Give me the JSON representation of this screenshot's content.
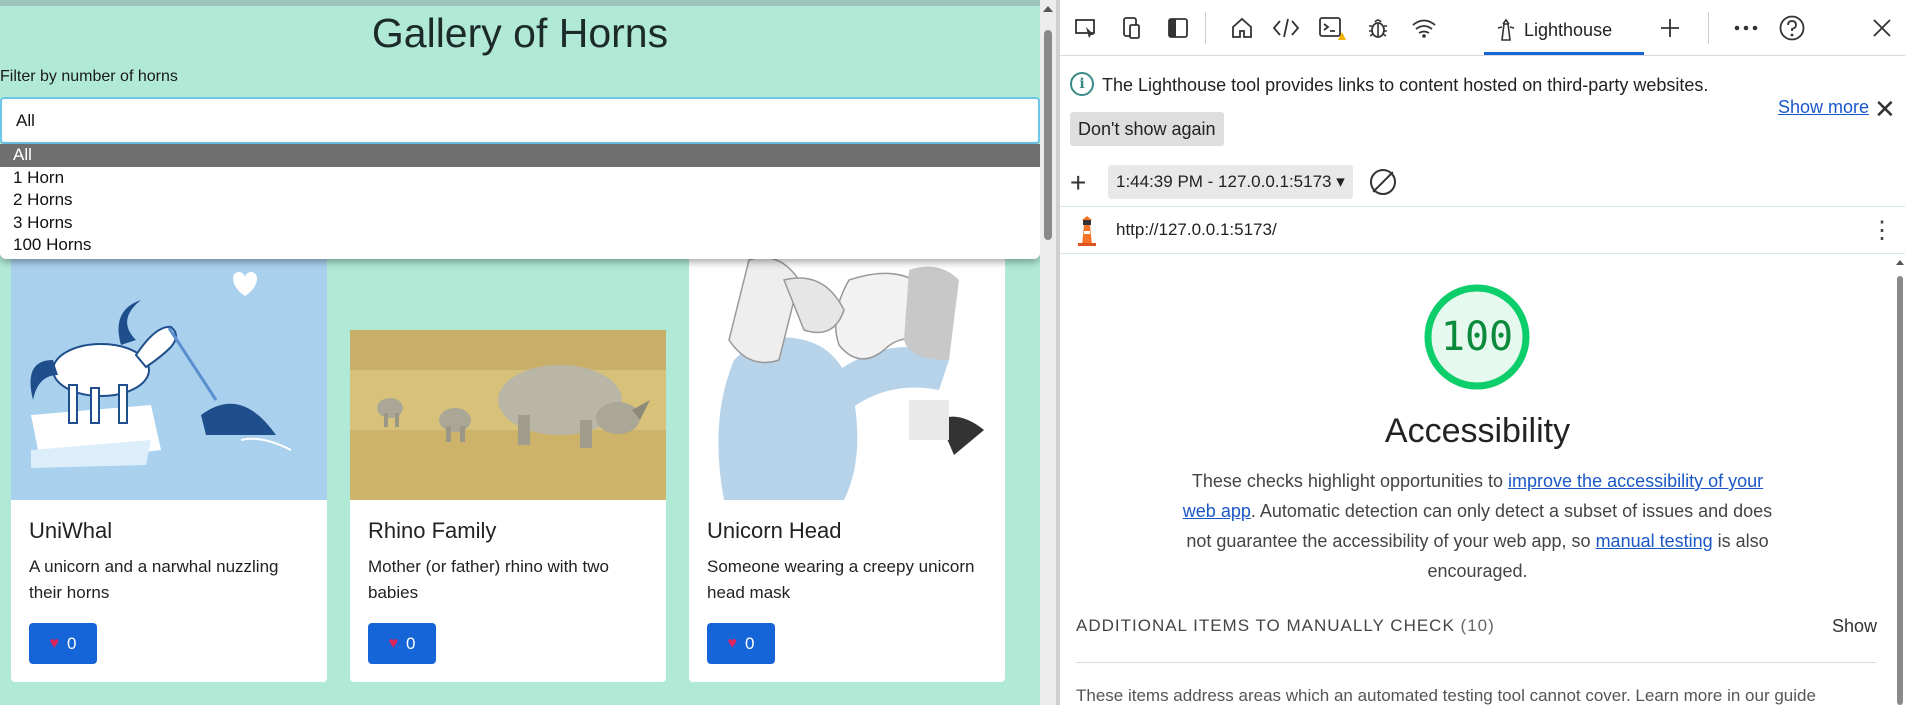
{
  "app": {
    "title": "Gallery of Horns",
    "filter_label": "Filter by number of horns",
    "filter_value": "All",
    "filter_options": [
      "All",
      "1 Horn",
      "2 Horns",
      "3 Horns",
      "100 Horns"
    ],
    "cards": [
      {
        "title": "UniWhal",
        "description": "A unicorn and a narwhal nuzzling their horns",
        "likes": "0"
      },
      {
        "title": "Rhino Family",
        "description": "Mother (or father) rhino with two babies",
        "likes": "0"
      },
      {
        "title": "Unicorn Head",
        "description": "Someone wearing a creepy unicorn head mask",
        "likes": "0"
      }
    ]
  },
  "devtools": {
    "active_tab": "Lighthouse",
    "toolbar_icons": [
      "inspect-icon",
      "device-icon",
      "dock-icon",
      "home-icon",
      "elements-icon",
      "console-icon",
      "bug-icon",
      "network-icon",
      "lighthouse-icon",
      "add-tab-icon",
      "more-icon",
      "help-icon",
      "close-icon"
    ],
    "infobar": {
      "message": "The Lighthouse tool provides links to content hosted on third-party websites.",
      "dont_show": "Don't show again",
      "show_more": "Show more"
    },
    "report_select": "1:44:39 PM - 127.0.0.1:5173",
    "url": "http://127.0.0.1:5173/",
    "score": "100",
    "score_fraction": 1.0,
    "category_title": "Accessibility",
    "description": {
      "part1": "These checks highlight opportunities to ",
      "link1": "improve the accessibility of your web app",
      "part2": ". Automatic detection can only detect a subset of issues and does not guarantee the accessibility of your web app, so ",
      "link2": "manual testing",
      "part3": " is also encouraged."
    },
    "manual_heading": "ADDITIONAL ITEMS TO MANUALLY CHECK",
    "manual_count": "(10)",
    "manual_show": "Show",
    "manual_desc": "These items address areas which an automated testing tool cannot cover. Learn more in our guide"
  },
  "colors": {
    "app_bg": "#b0ead6",
    "like_button": "#1565d8",
    "score_green": "#0cce6b",
    "link": "#1a57c9"
  }
}
